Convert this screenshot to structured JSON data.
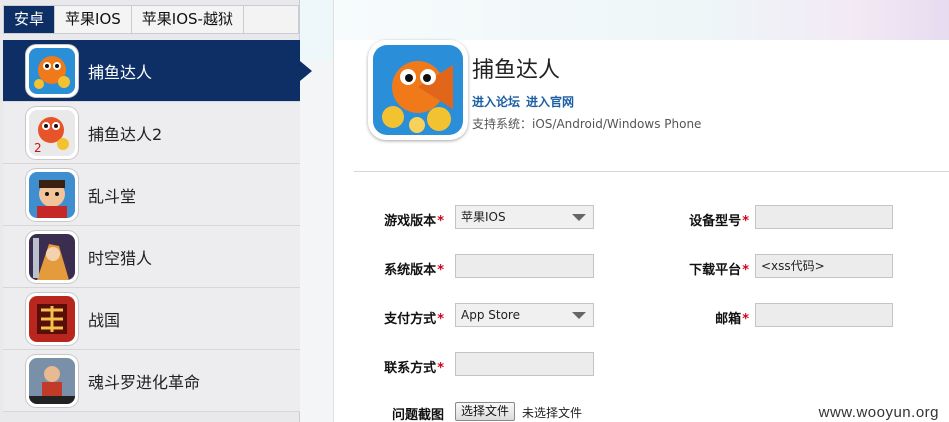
{
  "tabs": [
    {
      "label": "安卓"
    },
    {
      "label": "苹果IOS"
    },
    {
      "label": "苹果IOS-越狱"
    }
  ],
  "games": [
    {
      "name": "捕鱼达人",
      "icon": "fish-game-icon"
    },
    {
      "name": "捕鱼达人2",
      "icon": "fish-game-2-icon"
    },
    {
      "name": "乱斗堂",
      "icon": "fighter-game-icon"
    },
    {
      "name": "时空猎人",
      "icon": "hunter-game-icon"
    },
    {
      "name": "战国",
      "icon": "warring-states-icon"
    },
    {
      "name": "魂斗罗进化革命",
      "icon": "contra-game-icon"
    }
  ],
  "app": {
    "title": "捕鱼达人",
    "link_forum": "进入论坛",
    "link_site": "进入官网",
    "support": "支持系统：iOS/Android/Windows Phone"
  },
  "form": {
    "game_version_label": "游戏版本",
    "game_version_value": "苹果IOS",
    "system_version_label": "系统版本",
    "payment_label": "支付方式",
    "payment_value": "App Store",
    "contact_label": "联系方式",
    "screenshot_label": "问题截图",
    "device_label": "设备型号",
    "platform_label": "下载平台",
    "platform_value": "<xss代码>",
    "email_label": "邮箱",
    "required_mark": "*",
    "file_button": "选择文件",
    "file_status": "未选择文件"
  },
  "watermark": "www.wooyun.org",
  "colors": {
    "nav_dark": "#0e2f66",
    "link": "#1d5fa3",
    "required": "#d0021b"
  }
}
